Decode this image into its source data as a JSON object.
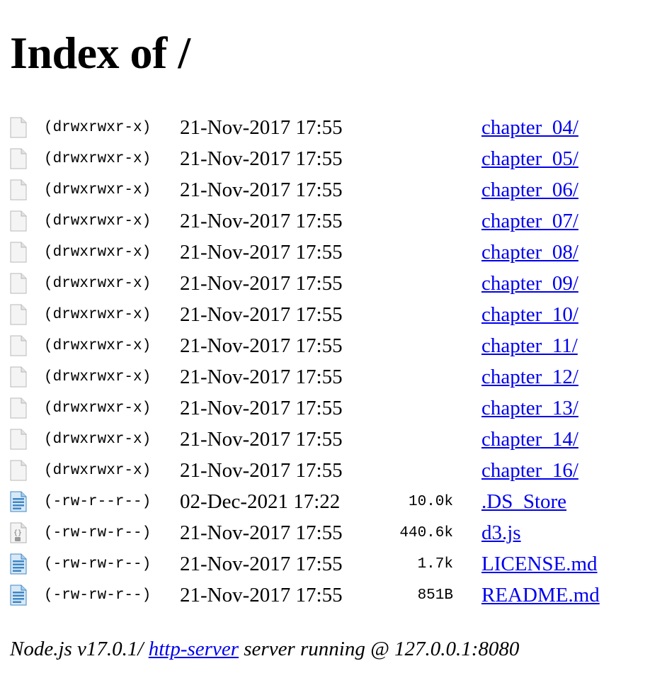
{
  "page": {
    "title": "Index of /"
  },
  "entries": [
    {
      "icon": "folder-icon",
      "permissions": "(drwxrwxr-x)",
      "date": "21-Nov-2017 17:55",
      "size": "",
      "name": "chapter_04/"
    },
    {
      "icon": "folder-icon",
      "permissions": "(drwxrwxr-x)",
      "date": "21-Nov-2017 17:55",
      "size": "",
      "name": "chapter_05/"
    },
    {
      "icon": "folder-icon",
      "permissions": "(drwxrwxr-x)",
      "date": "21-Nov-2017 17:55",
      "size": "",
      "name": "chapter_06/"
    },
    {
      "icon": "folder-icon",
      "permissions": "(drwxrwxr-x)",
      "date": "21-Nov-2017 17:55",
      "size": "",
      "name": "chapter_07/"
    },
    {
      "icon": "folder-icon",
      "permissions": "(drwxrwxr-x)",
      "date": "21-Nov-2017 17:55",
      "size": "",
      "name": "chapter_08/"
    },
    {
      "icon": "folder-icon",
      "permissions": "(drwxrwxr-x)",
      "date": "21-Nov-2017 17:55",
      "size": "",
      "name": "chapter_09/"
    },
    {
      "icon": "folder-icon",
      "permissions": "(drwxrwxr-x)",
      "date": "21-Nov-2017 17:55",
      "size": "",
      "name": "chapter_10/"
    },
    {
      "icon": "folder-icon",
      "permissions": "(drwxrwxr-x)",
      "date": "21-Nov-2017 17:55",
      "size": "",
      "name": "chapter_11/"
    },
    {
      "icon": "folder-icon",
      "permissions": "(drwxrwxr-x)",
      "date": "21-Nov-2017 17:55",
      "size": "",
      "name": "chapter_12/"
    },
    {
      "icon": "folder-icon",
      "permissions": "(drwxrwxr-x)",
      "date": "21-Nov-2017 17:55",
      "size": "",
      "name": "chapter_13/"
    },
    {
      "icon": "folder-icon",
      "permissions": "(drwxrwxr-x)",
      "date": "21-Nov-2017 17:55",
      "size": "",
      "name": "chapter_14/"
    },
    {
      "icon": "folder-icon",
      "permissions": "(drwxrwxr-x)",
      "date": "21-Nov-2017 17:55",
      "size": "",
      "name": "chapter_16/"
    },
    {
      "icon": "text-file-icon",
      "permissions": "(-rw-r--r--)",
      "date": "02-Dec-2021 17:22",
      "size": "10.0k",
      "name": ".DS_Store"
    },
    {
      "icon": "code-file-icon",
      "permissions": "(-rw-rw-r--)",
      "date": "21-Nov-2017 17:55",
      "size": "440.6k",
      "name": "d3.js"
    },
    {
      "icon": "text-file-icon",
      "permissions": "(-rw-rw-r--)",
      "date": "21-Nov-2017 17:55",
      "size": "1.7k",
      "name": "LICENSE.md"
    },
    {
      "icon": "text-file-icon",
      "permissions": "(-rw-rw-r--)",
      "date": "21-Nov-2017 17:55",
      "size": "851B",
      "name": "README.md"
    }
  ],
  "footer": {
    "prefix": "Node.js v17.0.1/ ",
    "link_text": "http-server",
    "suffix": " server running @ 127.0.0.1:8080"
  },
  "colors": {
    "link": "#0000ee",
    "text_file_icon": "#4a90c8"
  }
}
